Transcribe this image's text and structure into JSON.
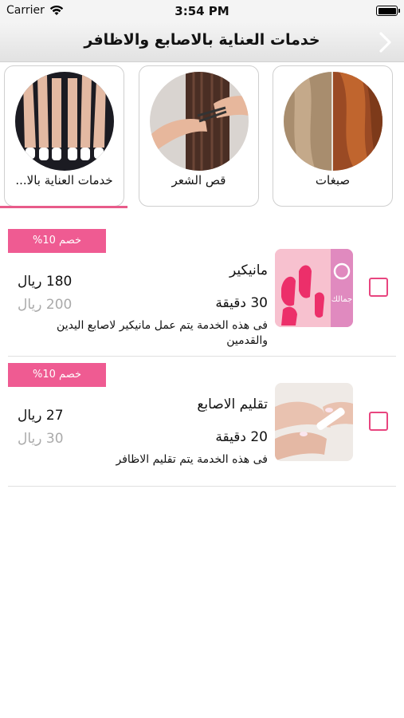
{
  "status_bar": {
    "carrier": "Carrier",
    "time": "3:54 PM"
  },
  "nav": {
    "title": "خدمات العناية بالاصابع والاظافر"
  },
  "categories": [
    {
      "label": "صبغات"
    },
    {
      "label": "قص الشعر"
    },
    {
      "label": "خدمات العناية بالا..."
    }
  ],
  "services": [
    {
      "discount": "خصم 10%",
      "name": "مانيكير",
      "duration": "30 دقيقة",
      "price": "180 ريال",
      "old_price": "200 ريال",
      "description": "فى هذه الخدمة يتم عمل مانيكير لاصابع اليدين والقدمين",
      "thumb_logo_text": "جمالك"
    },
    {
      "discount": "خصم 10%",
      "name": "تقليم الاصابع",
      "duration": "20 دقيقة",
      "price": "27 ريال",
      "old_price": "30 ريال",
      "description": "فى هذه الخدمة يتم تقليم الاظافر"
    }
  ],
  "colors": {
    "accent": "#ef5b92",
    "checkbox": "#e8457f",
    "nav_bg": "#ececec"
  }
}
